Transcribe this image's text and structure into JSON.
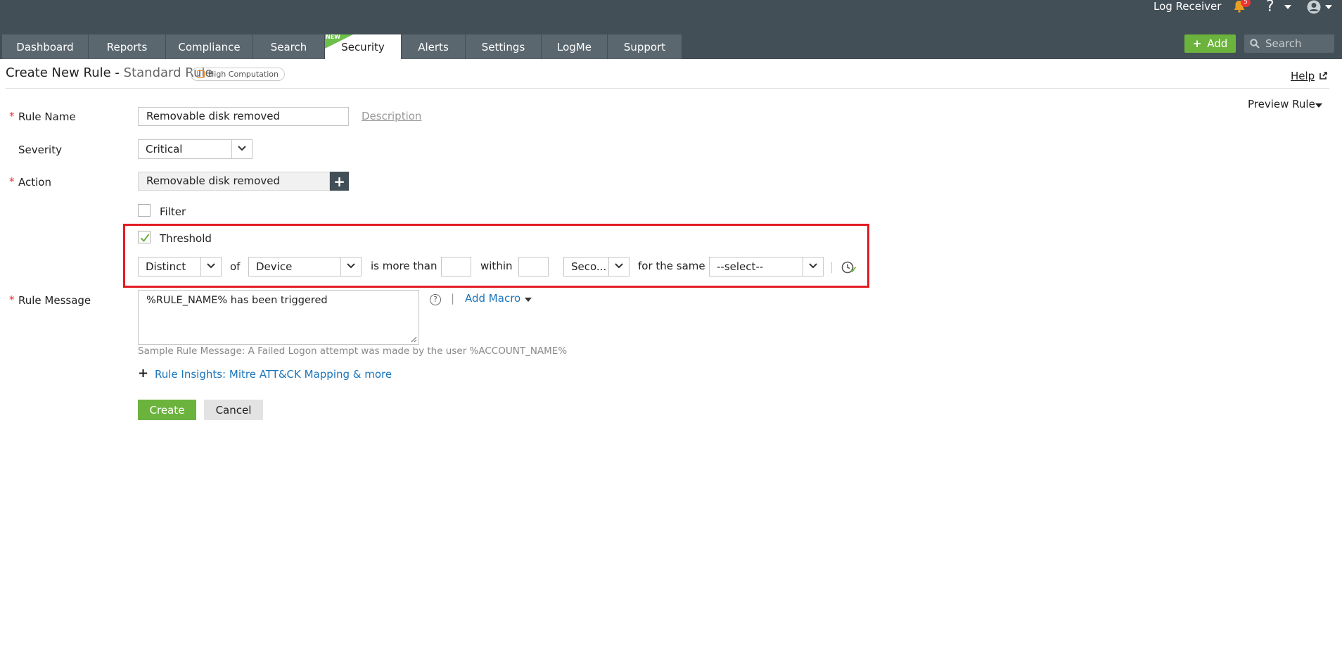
{
  "header": {
    "user_label": "Log Receiver",
    "notification_count": "5",
    "help_symbol": "?",
    "tabs": [
      {
        "label": "Dashboard",
        "active": false
      },
      {
        "label": "Reports",
        "active": false
      },
      {
        "label": "Compliance",
        "active": false
      },
      {
        "label": "Search",
        "active": false
      },
      {
        "label": "Security",
        "active": true,
        "flag": "NEW"
      },
      {
        "label": "Alerts",
        "active": false
      },
      {
        "label": "Settings",
        "active": false
      },
      {
        "label": "LogMe",
        "active": false
      },
      {
        "label": "Support",
        "active": false
      }
    ],
    "add_label": "Add",
    "search_placeholder": "Search"
  },
  "page": {
    "title": "Create New Rule",
    "title_sep": " - ",
    "subtitle": "Standard Rule",
    "badge": "High Computation",
    "help": "Help",
    "preview": "Preview Rule"
  },
  "form": {
    "required_mark": "*",
    "rule_name_label": "Rule Name",
    "rule_name_value": "Removable disk removed",
    "description_link": "Description",
    "severity_label": "Severity",
    "severity_value": "Critical",
    "action_label": "Action",
    "action_value": "Removable disk removed",
    "filter_label": "Filter",
    "filter_checked": false,
    "threshold_label": "Threshold",
    "threshold_checked": true,
    "threshold": {
      "aggregate": "Distinct",
      "of": "of",
      "field": "Device",
      "more_than": "is more than",
      "count_value": "",
      "within": "within",
      "time_value": "",
      "unit": "Seco...",
      "same": "for the same",
      "same_select": "--select--"
    },
    "rule_message_label": "Rule Message",
    "rule_message_value": "%RULE_NAME% has been triggered",
    "help_q": "?",
    "pipe": "|",
    "add_macro": "Add Macro",
    "sample": "Sample Rule Message: A Failed Logon attempt was made by the user %ACCOUNT_NAME%",
    "insights_plus": "+",
    "insights": "Rule Insights: Mitre ATT&CK Mapping & more",
    "create": "Create",
    "cancel": "Cancel"
  },
  "colors": {
    "header_bg": "#434f57",
    "tab_bg": "#5a676f",
    "accent_green": "#6cb33e",
    "link_blue": "#1b75bc",
    "highlight_red": "#e31b23"
  }
}
